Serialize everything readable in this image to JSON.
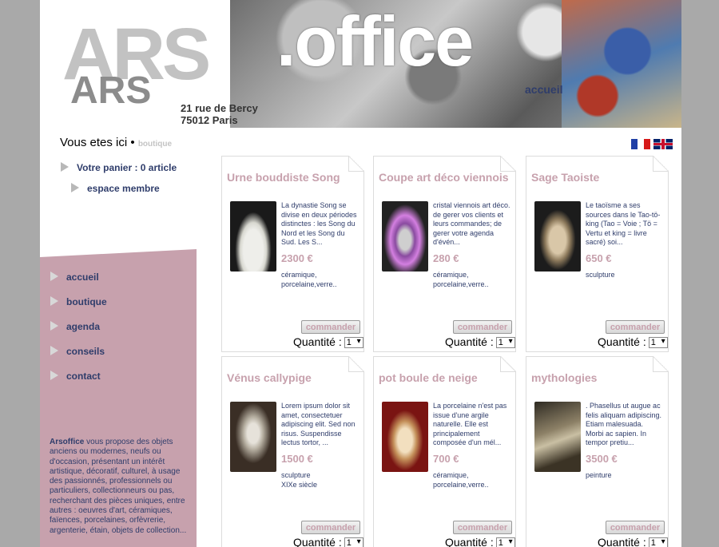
{
  "header": {
    "logo_ars": "ARS",
    "logo_office": ".office",
    "logo_small": "ARS",
    "address_line1": "21 rue de Bercy",
    "address_line2": "75012 Paris",
    "nav_accueil": "accueil"
  },
  "breadcrumb": {
    "label": "Vous etes ici",
    "separator": "•",
    "current": "boutique"
  },
  "flags": [
    "fr-flag-icon",
    "uk-flag-icon"
  ],
  "user_links": {
    "panier": "Votre panier : 0 article",
    "membre": "espace membre"
  },
  "nav": [
    {
      "label": "accueil"
    },
    {
      "label": "boutique"
    },
    {
      "label": "agenda"
    },
    {
      "label": "conseils"
    },
    {
      "label": "contact"
    }
  ],
  "about": {
    "brand": "Arsoffice",
    "text": " vous propose des objets anciens ou modernes, neufs ou d'occasion, présentant un intérêt artistique, décoratif, culturel, à usage des passionnés, professionnels ou particuliers, collectionneurs ou pas, recherchant des pièces uniques, entre autres : oeuvres d'art, céramiques, faïences, porcelaines, orfèvrerie, argenterie, étain, objets de collection..."
  },
  "products": [
    {
      "title": "Urne bouddiste Song",
      "desc": "La dynastie Song se divise en deux périodes distinctes : les Song du Nord et les Song du Sud. Les S...",
      "price": "2300 €",
      "category": "céramique, porcelaine,verre..",
      "button": "commander",
      "qty_label": "Quantité :",
      "qty_value": "1"
    },
    {
      "title": "Coupe art déco viennois",
      "desc": "cristal viennois art déco. de gerer vos clients et leurs commandes; de gerer votre agenda d'évén...",
      "price": "280 €",
      "category": "céramique, porcelaine,verre..",
      "button": "commander",
      "qty_label": "Quantité :",
      "qty_value": "1"
    },
    {
      "title": "Sage Taoiste",
      "desc": "Le taoïsme a ses sources dans le Tao-tö-king (Tao = Voie ; Tö = Vertu et king = livre sacré) soi...",
      "price": "650 €",
      "category": "sculpture",
      "button": "commander",
      "qty_label": "Quantité :",
      "qty_value": "1"
    },
    {
      "title": "Vénus callypige",
      "desc": "Lorem ipsum dolor sit amet, consectetuer adipiscing elit. Sed non risus. Suspendisse lectus tortor, ...",
      "price": "1500 €",
      "category": "sculpture\nXIXe siècle",
      "button": "commander",
      "qty_label": "Quantité :",
      "qty_value": "1"
    },
    {
      "title": "pot boule de neige",
      "desc": "La porcelaine n'est pas issue d'une argile naturelle. Elle est principalement composée d'un mél...",
      "price": "700 €",
      "category": "céramique, porcelaine,verre..",
      "button": "commander",
      "qty_label": "Quantité :",
      "qty_value": "1"
    },
    {
      "title": "mythologies",
      "desc": ". Phasellus ut augue ac felis aliquam adipiscing. Etiam malesuada. Morbi ac sapien. In tempor pretiu...",
      "price": "3500 €",
      "category": "peinture",
      "button": "commander",
      "qty_label": "Quantité :",
      "qty_value": "1"
    }
  ]
}
